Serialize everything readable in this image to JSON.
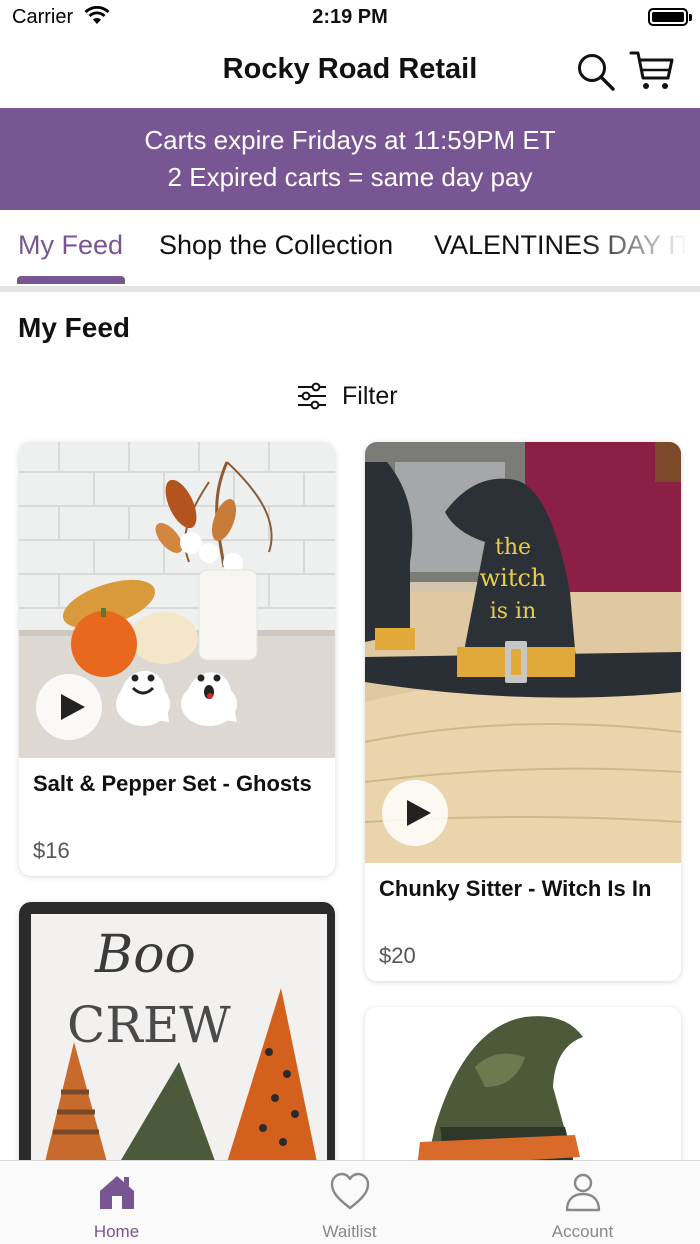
{
  "status_bar": {
    "carrier": "Carrier",
    "time": "2:19 PM"
  },
  "header": {
    "title": "Rocky Road Retail",
    "icons": [
      "search-icon",
      "cart-icon"
    ]
  },
  "banner": {
    "line1": "Carts expire Fridays at 11:59PM ET",
    "line2": "2 Expired carts = same day pay"
  },
  "tabs": [
    {
      "label": "My Feed",
      "active": true
    },
    {
      "label": "Shop the Collection",
      "active": false
    },
    {
      "label": "VALENTINES DAY ITEMS",
      "active": false
    }
  ],
  "section": {
    "title": "My Feed"
  },
  "filter": {
    "label": "Filter",
    "icon": "sliders-icon"
  },
  "products": [
    {
      "name": "Salt & Pepper Set - Ghosts",
      "price": "$16",
      "has_video": true
    },
    {
      "name": "Chunky Sitter - Witch Is In",
      "price": "$20",
      "has_video": true
    },
    {
      "name": "",
      "price": "",
      "has_video": true
    },
    {
      "name": "",
      "price": "",
      "has_video": false
    }
  ],
  "tab_bar": [
    {
      "label": "Home",
      "icon": "home-icon",
      "active": true
    },
    {
      "label": "Waitlist",
      "icon": "heart-icon",
      "active": false
    },
    {
      "label": "Account",
      "icon": "user-icon",
      "active": false
    }
  ],
  "colors": {
    "brand": "#785593",
    "text": "#111111",
    "muted": "#888888",
    "price": "#555555"
  }
}
